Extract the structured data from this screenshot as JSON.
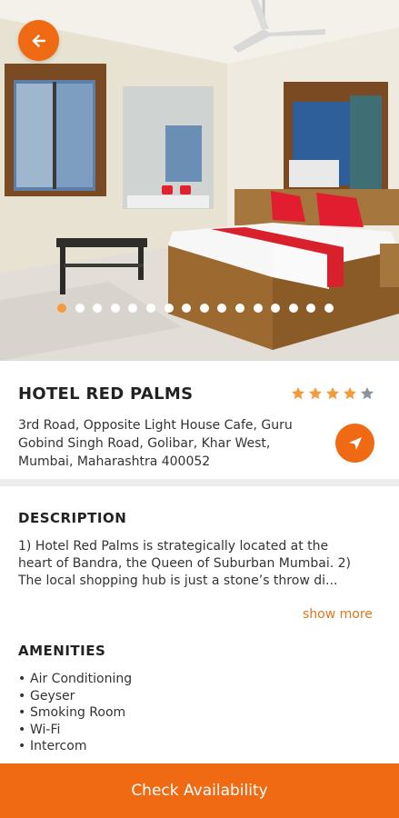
{
  "hotel": {
    "name": "HOTEL RED PALMS",
    "rating": 4,
    "rating_max": 5,
    "address": "3rd Road, Opposite Light House Cafe, Guru Gobind Singh Road, Golibar, Khar West, Mumbai, Maharashtra 400052"
  },
  "gallery": {
    "image_count": 16,
    "active_index": 0
  },
  "description": {
    "title": "DESCRIPTION",
    "text": "1) Hotel Red Palms is strategically located at the heart of Bandra, the Queen of Suburban Mumbai. 2) The local shopping hub is just a stone’s throw di...",
    "show_more_label": "show more"
  },
  "amenities": {
    "title": "AMENITIES",
    "items": [
      "Air Conditioning",
      "Geyser",
      "Smoking Room",
      "Wi-Fi",
      "Intercom"
    ]
  },
  "footer": {
    "cta_label": "Check Availability"
  },
  "icons": {
    "back": "arrow-left-icon",
    "navigate": "navigation-arrow-icon",
    "star": "star-icon"
  },
  "colors": {
    "accent": "#f06a14",
    "star_filled": "#f39a3b",
    "star_empty": "#8a9399",
    "dot_active": "#f39a3b",
    "link": "#e0771d"
  }
}
